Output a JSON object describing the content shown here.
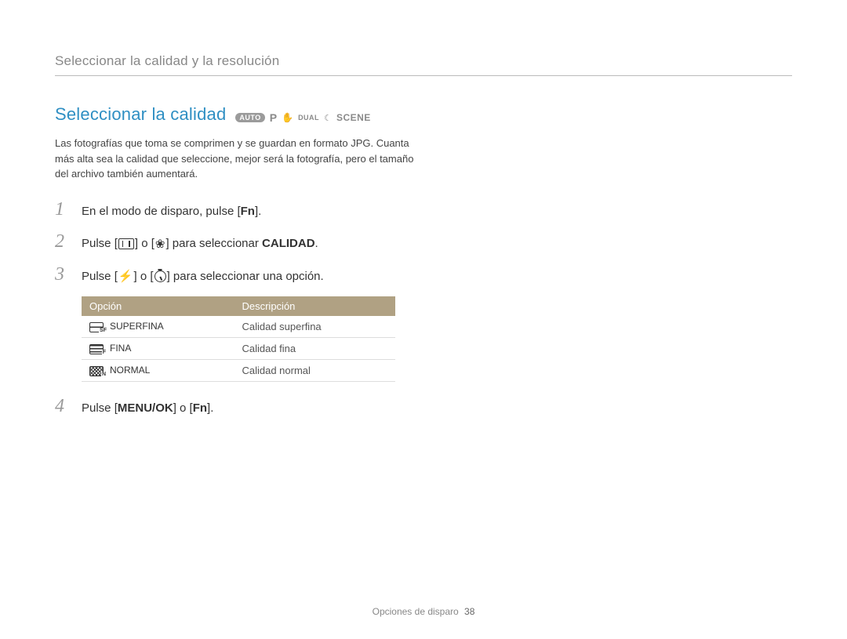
{
  "header": {
    "running_head": "Seleccionar la calidad y la resolución"
  },
  "section": {
    "title": "Seleccionar la calidad",
    "modes": {
      "auto": "AUTO",
      "p": "P",
      "dual": "DUAL",
      "scene": "SCENE"
    }
  },
  "intro": "Las fotografías que toma se comprimen y se guardan en formato JPG. Cuanta más alta sea la calidad que seleccione, mejor será la fotografía, pero el tamaño del archivo también aumentará.",
  "steps": {
    "s1": {
      "num": "1",
      "pre": "En el modo de disparo, pulse [",
      "btn": "Fn",
      "post": "]."
    },
    "s2": {
      "num": "2",
      "pre": "Pulse [",
      "mid": "] o [",
      "post": "] para seleccionar ",
      "bold": "CALIDAD",
      "end": "."
    },
    "s3": {
      "num": "3",
      "pre": "Pulse [",
      "mid": "] o [",
      "post": "] para seleccionar una opción."
    },
    "s4": {
      "num": "4",
      "pre": "Pulse [",
      "b1": "MENU/OK",
      "mid": "] o [",
      "b2": "Fn",
      "post": "]."
    }
  },
  "table": {
    "headers": {
      "opcion": "Opción",
      "desc": "Descripción"
    },
    "rows": [
      {
        "label": "SUPERFINA",
        "desc": "Calidad superfina"
      },
      {
        "label": "FINA",
        "desc": "Calidad fina"
      },
      {
        "label": "NORMAL",
        "desc": "Calidad normal"
      }
    ]
  },
  "footer": {
    "section": "Opciones de disparo",
    "page": "38"
  }
}
